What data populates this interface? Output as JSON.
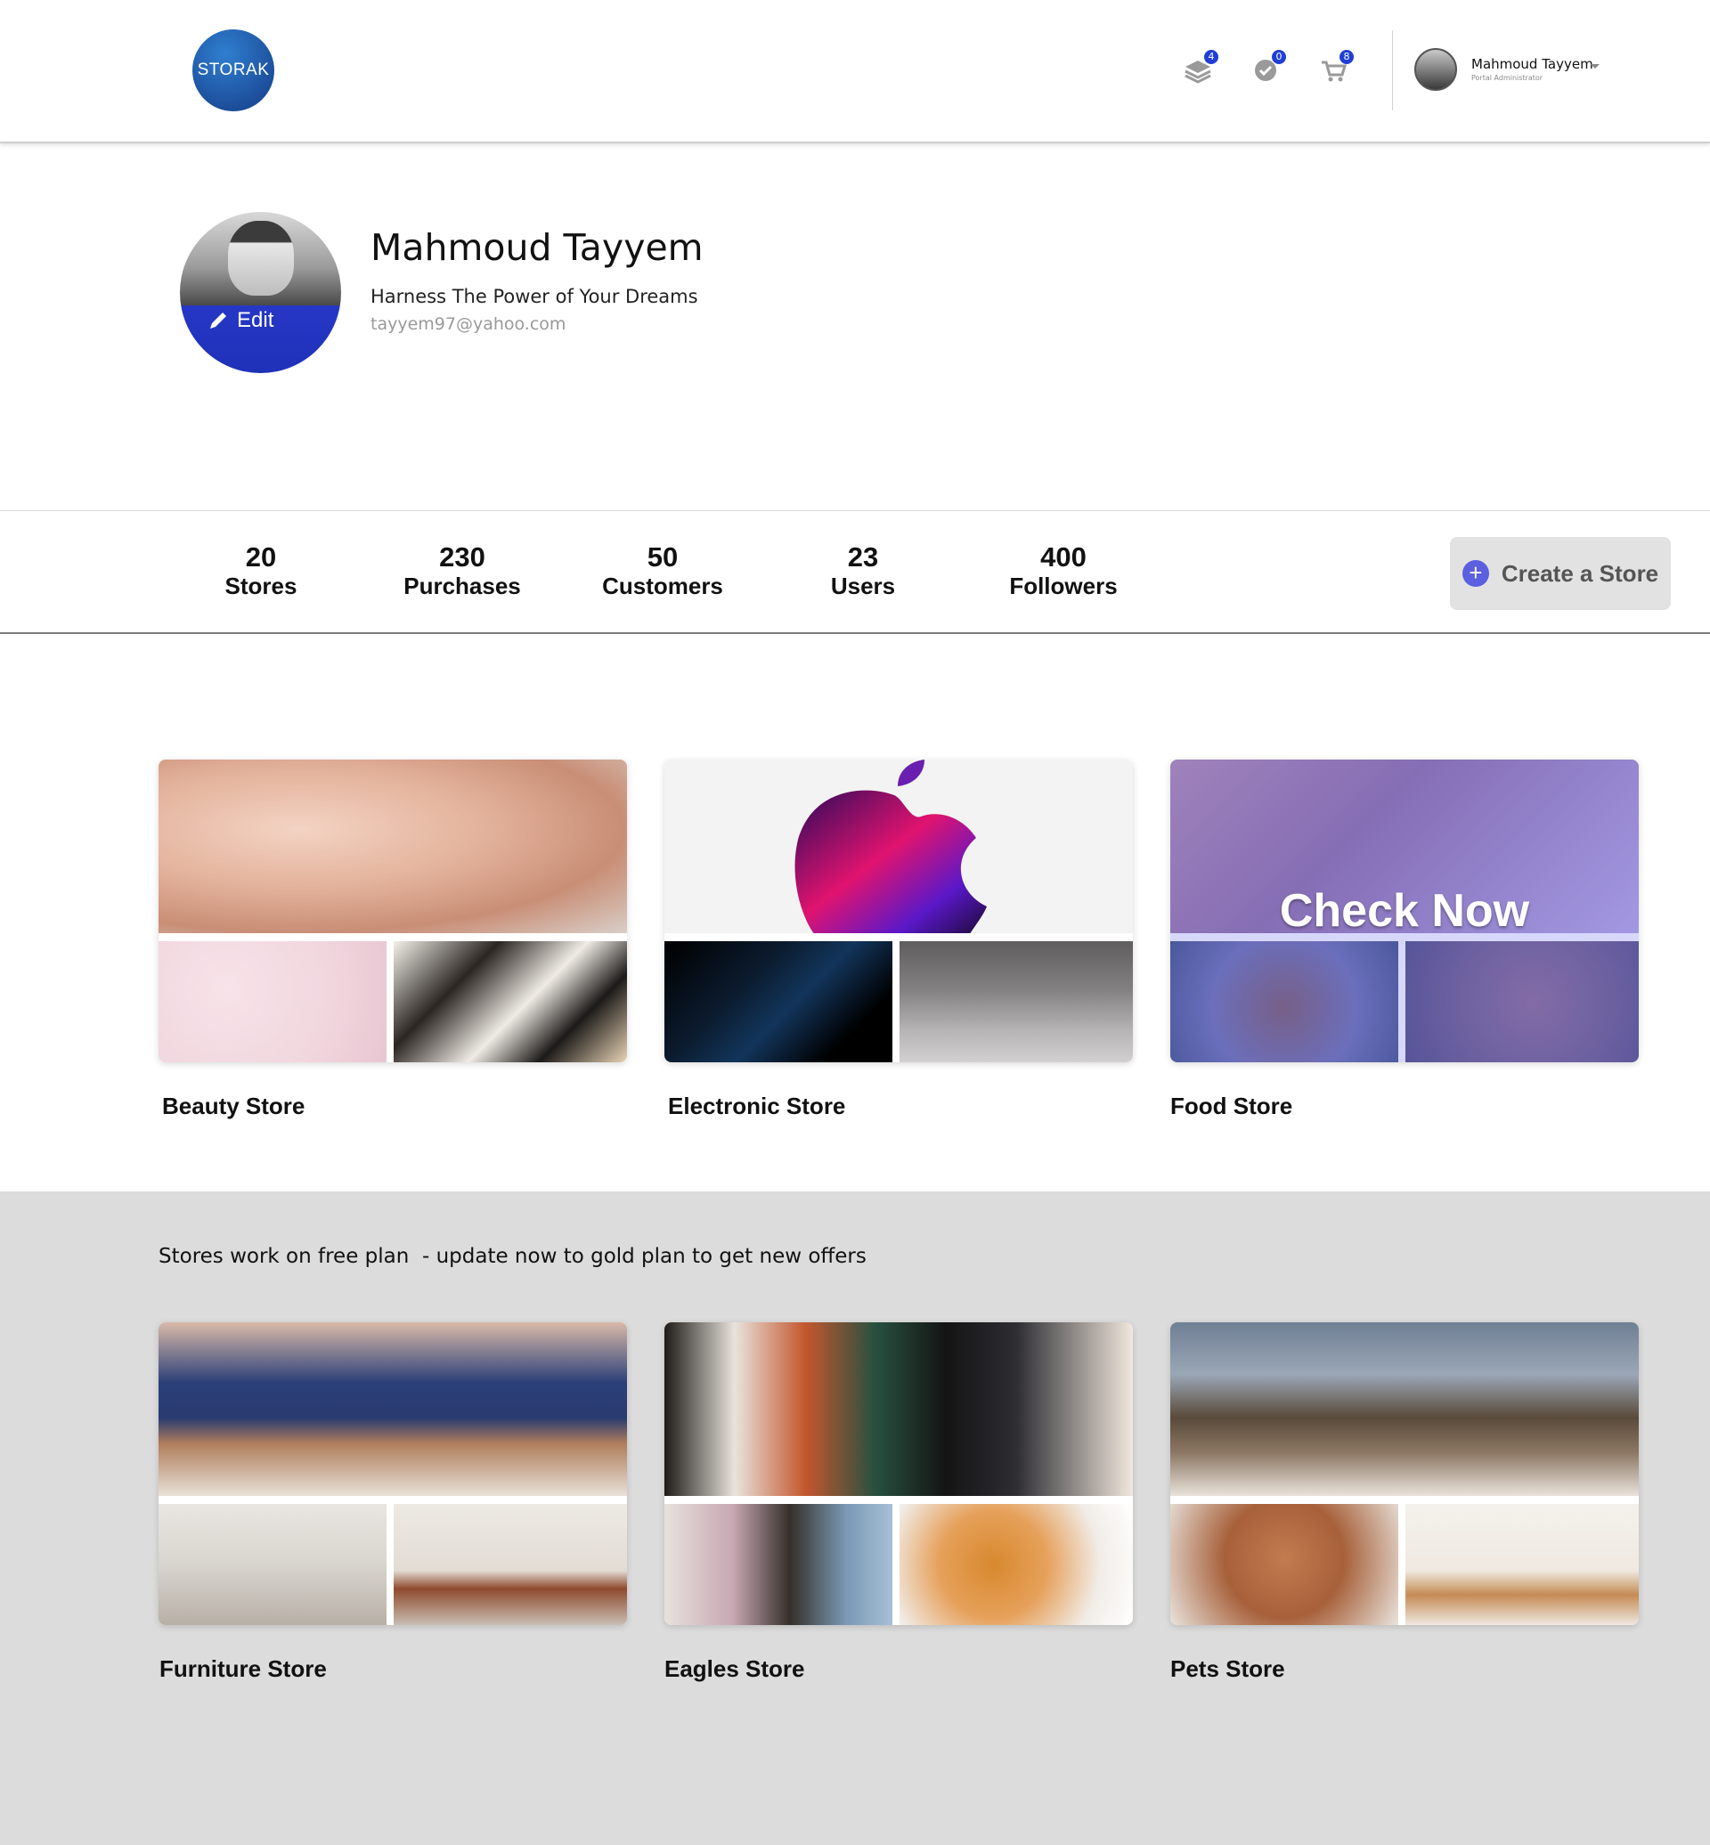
{
  "header": {
    "logo_text": "STORAK",
    "nav": [
      {
        "icon": "layers-icon",
        "badge": "4"
      },
      {
        "icon": "check-circle-icon",
        "badge": "0"
      },
      {
        "icon": "cart-icon",
        "badge": "8"
      }
    ],
    "user_name": "Mahmoud Tayyem",
    "user_role": "Portal Administrator"
  },
  "profile": {
    "edit_label": "Edit",
    "name": "Mahmoud Tayyem",
    "tagline": "Harness The Power of Your Dreams",
    "email": "tayyem97@yahoo.com"
  },
  "stats": [
    {
      "value": "20",
      "label": "Stores"
    },
    {
      "value": "230",
      "label": "Purchases"
    },
    {
      "value": "50",
      "label": "Customers"
    },
    {
      "value": "23",
      "label": "Users"
    },
    {
      "value": "400",
      "label": "Followers"
    }
  ],
  "create_store_label": "Create a Store",
  "stores": [
    {
      "title": "Beauty Store"
    },
    {
      "title": "Electronic Store"
    },
    {
      "title": "Food Store",
      "overlay_text": "Check Now"
    }
  ],
  "plan_notice": "Stores work on free plan  - update now to gold plan to get new offers",
  "free_stores": [
    {
      "title": "Furniture Store"
    },
    {
      "title": "Eagles Store"
    },
    {
      "title": "Pets Store"
    }
  ],
  "colors": {
    "accent": "#1f3fd6",
    "create_button_bg": "#e2e2e2",
    "plus_icon": "#5b5fe0",
    "grey_section": "#dcdcdc"
  }
}
